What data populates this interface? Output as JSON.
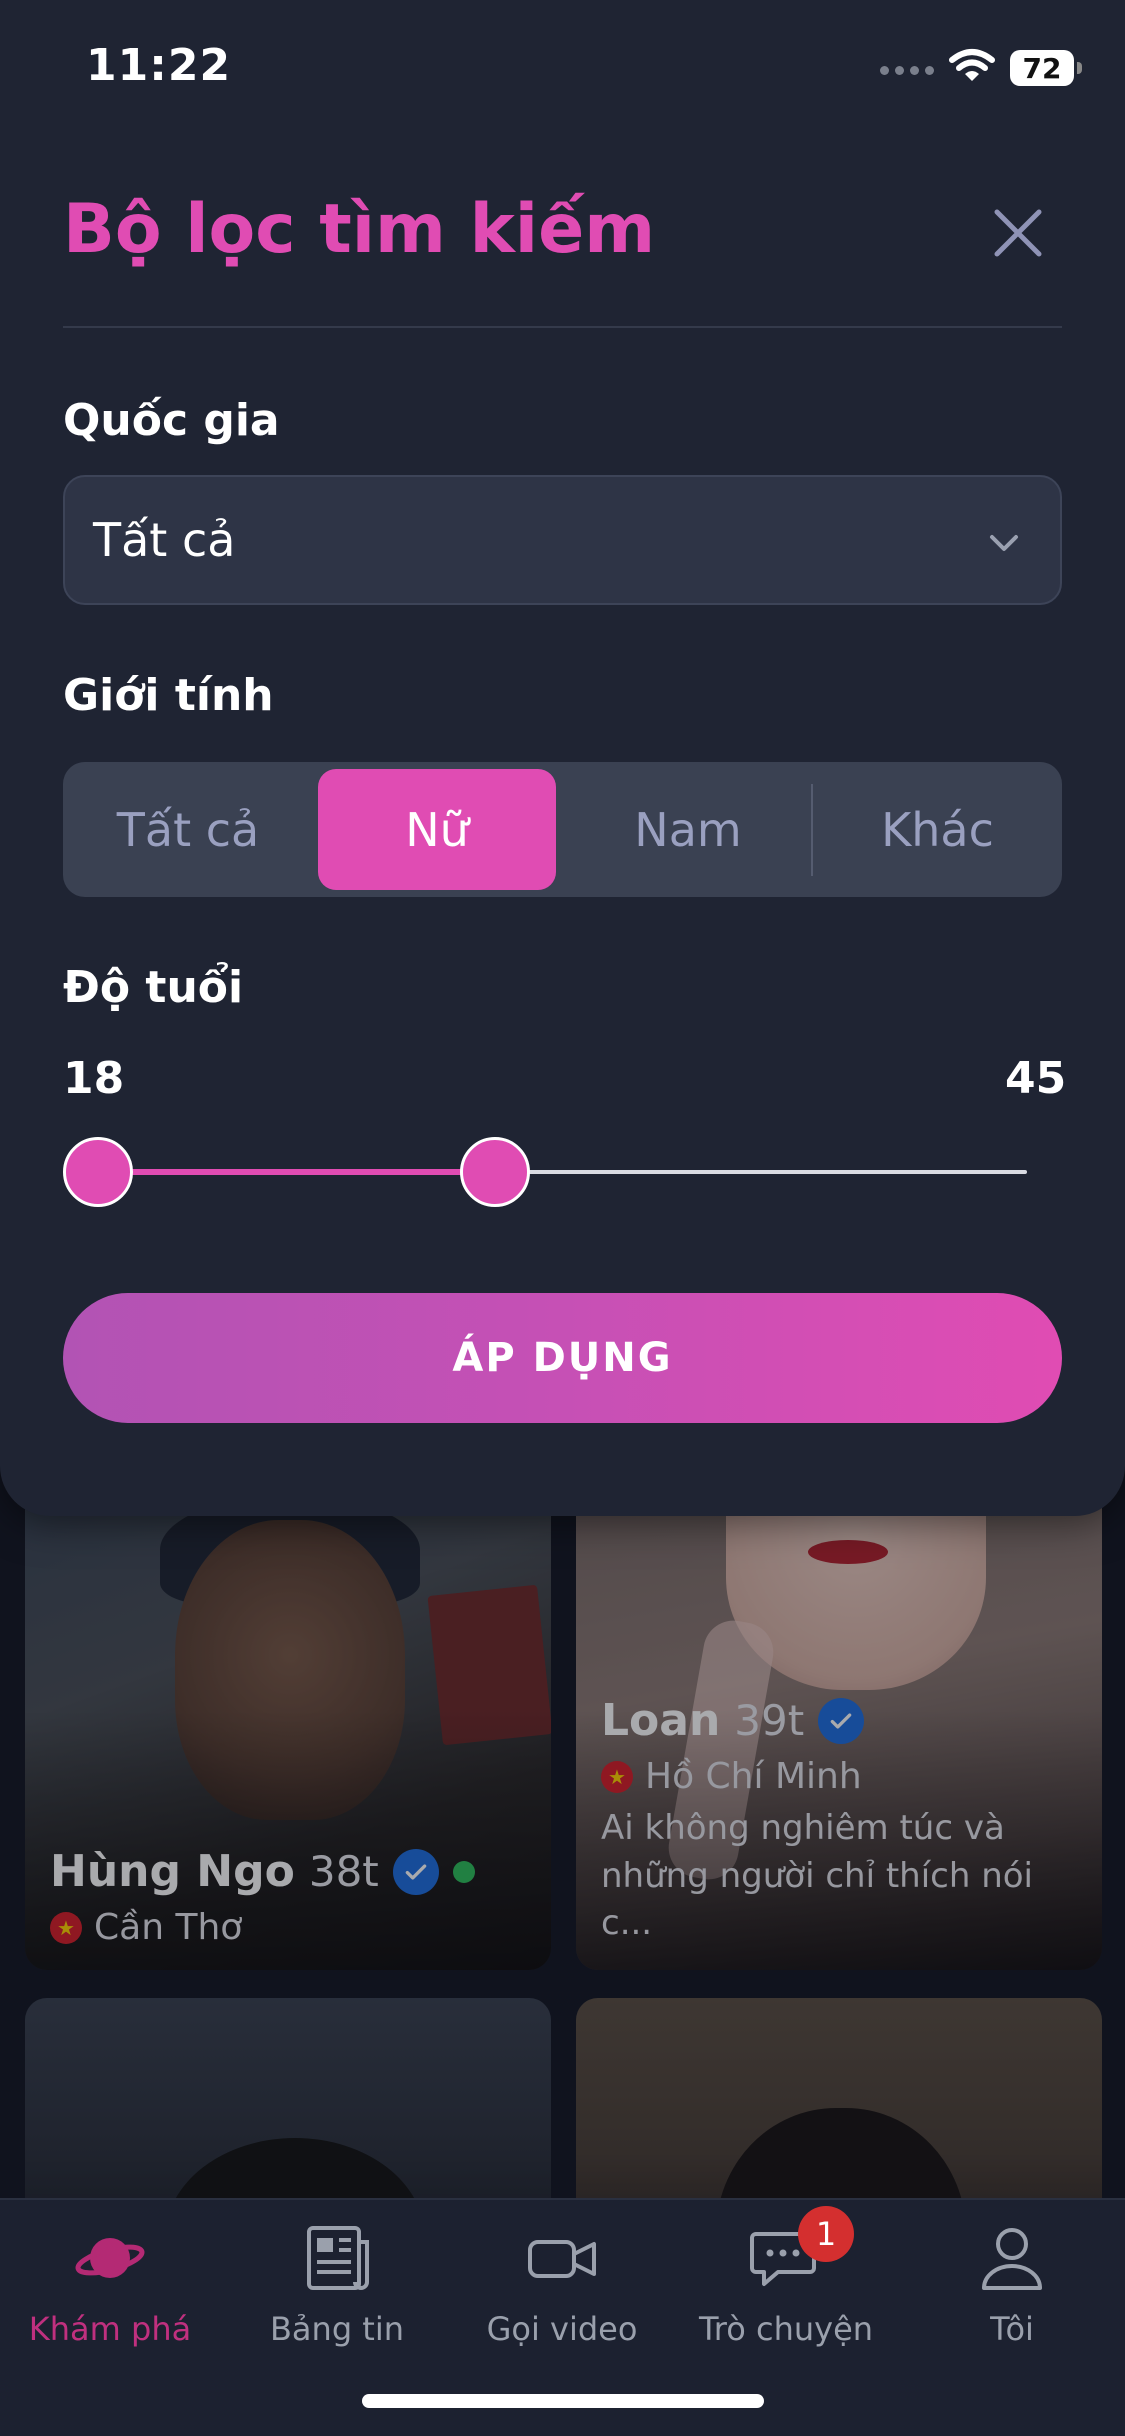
{
  "status_bar": {
    "time": "11:22",
    "battery": "72"
  },
  "filter": {
    "title": "Bộ lọc tìm kiếm",
    "country": {
      "label": "Quốc gia",
      "value": "Tất cả"
    },
    "gender": {
      "label": "Giới tính",
      "options": [
        "Tất cả",
        "Nữ",
        "Nam",
        "Khác"
      ],
      "selected": "Nữ"
    },
    "age": {
      "label": "Độ tuổi",
      "min": "18",
      "max": "45",
      "range_min": 18,
      "range_max": 45,
      "thumb_low": 18,
      "thumb_high": 30
    },
    "apply_label": "ÁP DỤNG"
  },
  "colors": {
    "accent": "#e04cb3",
    "sheet_bg": "#1f2433",
    "verified": "#1f6fe0",
    "online": "#2fbf5b"
  },
  "profiles": [
    {
      "name": "Hùng Ngo",
      "age": "38t",
      "location": "Cần Thơ",
      "verified": true,
      "online": true,
      "bio": ""
    },
    {
      "name": "Loan",
      "age": "39t",
      "location": "Hồ Chí Minh",
      "verified": true,
      "online": false,
      "bio": "Ai không nghiêm túc và những người chỉ thích nói c..."
    }
  ],
  "tabs": [
    {
      "label": "Khám phá",
      "icon": "planet-icon",
      "active": true
    },
    {
      "label": "Bảng tin",
      "icon": "newspaper-icon",
      "active": false
    },
    {
      "label": "Gọi video",
      "icon": "video-camera-icon",
      "active": false
    },
    {
      "label": "Trò chuyện",
      "icon": "chat-icon",
      "active": false,
      "badge": "1"
    },
    {
      "label": "Tôi",
      "icon": "user-icon",
      "active": false
    }
  ]
}
